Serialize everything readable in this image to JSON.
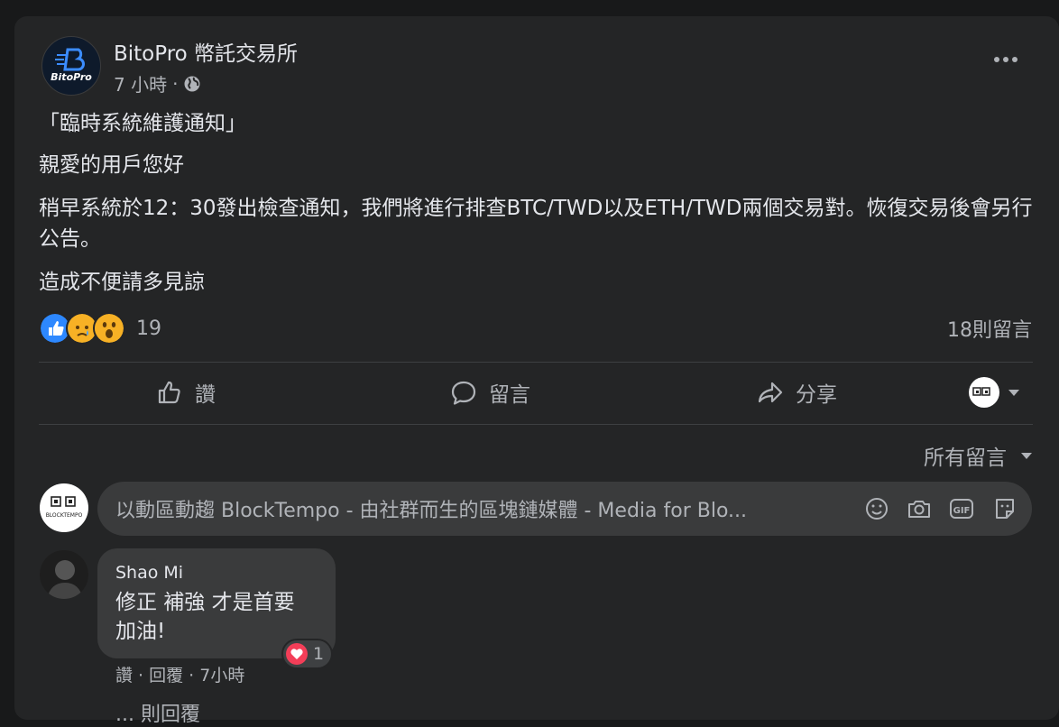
{
  "post": {
    "page_name": "BitoPro 幣託交易所",
    "avatar_text": "BitoPro",
    "time": "7 小時",
    "meta_dot": "·",
    "lines": [
      "「臨時系統維護通知」",
      "親愛的用戶您好",
      "稍早系統於12：30發出檢查通知，我們將進行排查BTC/TWD以及ETH/TWD兩個交易對。恢復交易後會另行公告。",
      "造成不便請多見諒"
    ],
    "reaction_count": "19",
    "comment_count": "18則留言",
    "reactions": [
      "like-icon",
      "sad-icon",
      "wow-icon"
    ]
  },
  "actions": {
    "like": "讚",
    "comment": "留言",
    "share": "分享"
  },
  "sort": {
    "label": "所有留言"
  },
  "composer": {
    "placeholder": "以動區動趨 BlockTempo - 由社群而生的區塊鏈媒體 - Media for Blo...",
    "gif": "GIF",
    "avatar_text": "BLOCKTEMPO"
  },
  "comments": [
    {
      "author": "Shao Mi",
      "line1": "修正 補強 才是首要",
      "line2": "加油!",
      "reaction_count": "1",
      "actions": "讚 · 回覆 · 7小時"
    }
  ],
  "more_replies_partial": "... 則回覆",
  "colors": {
    "background": "#18191a",
    "card": "#242526",
    "bubble": "#3a3b3c",
    "text": "#e4e6eb",
    "muted": "#b0b3b8",
    "like_blue": "#2d88ff",
    "love_red": "#f33e58"
  }
}
